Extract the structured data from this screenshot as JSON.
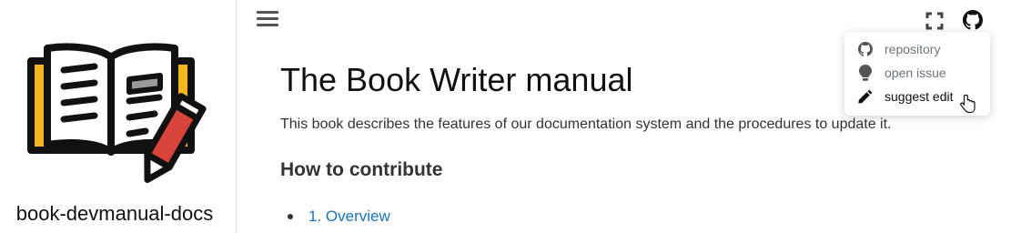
{
  "sidebar": {
    "site_title": "book-devmanual-docs"
  },
  "header": {
    "menu_icon": "hamburger-icon",
    "fullscreen_icon": "fullscreen-icon",
    "github_icon": "github-icon"
  },
  "dropdown": {
    "items": [
      {
        "label": "repository",
        "icon": "github-icon"
      },
      {
        "label": "open issue",
        "icon": "lightbulb-icon"
      },
      {
        "label": "suggest edit",
        "icon": "pencil-icon"
      }
    ]
  },
  "main": {
    "title": "The Book Writer manual",
    "description": "This book describes the features of our documentation system and the procedures to update it.",
    "section_title": "How to contribute",
    "toc": [
      {
        "label": "1. Overview"
      }
    ]
  },
  "colors": {
    "link": "#1a73c0",
    "book_orange": "#f5b51e",
    "pencil_red": "#d9443a",
    "book_gray": "#9a9a9a"
  }
}
